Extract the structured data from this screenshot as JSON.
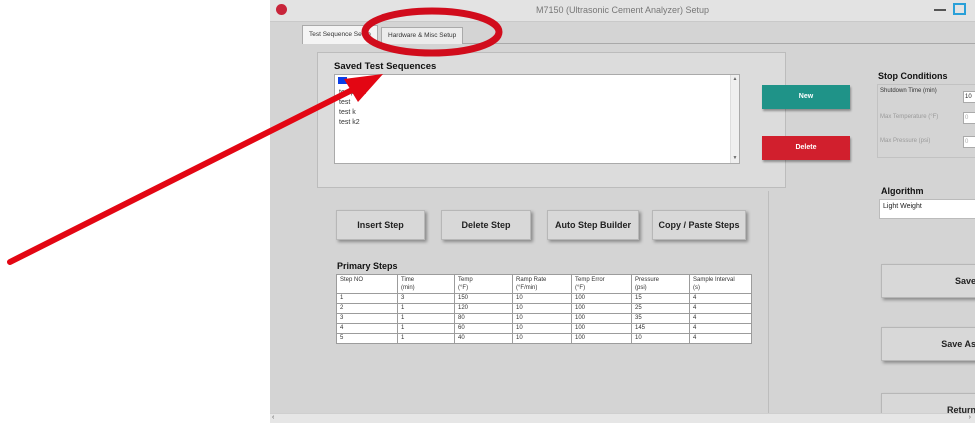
{
  "window": {
    "title": "M7150 (Ultrasonic Cement Analyzer) Setup"
  },
  "tabs": [
    {
      "label": "Test Sequence Setup"
    },
    {
      "label": "Hardware & Misc Setup"
    }
  ],
  "saved_sequences": {
    "title": "Saved Test Sequences",
    "items": [
      "temptest",
      "test",
      "test k",
      "test k2"
    ],
    "new_label": "New",
    "delete_label": "Delete"
  },
  "step_buttons": {
    "insert": "Insert Step",
    "delete": "Delete Step",
    "auto": "Auto Step Builder",
    "copy": "Copy / Paste Steps"
  },
  "primary_steps": {
    "title": "Primary Steps",
    "headers": [
      [
        "Step NO",
        ""
      ],
      [
        "Time",
        "(min)"
      ],
      [
        "Temp",
        "(°F)"
      ],
      [
        "Ramp Rate",
        "(°F/min)"
      ],
      [
        "Temp Error",
        "(°F)"
      ],
      [
        "Pressure",
        "(psi)"
      ],
      [
        "Sample Interval",
        "(s)"
      ]
    ],
    "rows": [
      [
        "1",
        "3",
        "150",
        "10",
        "100",
        "15",
        "4"
      ],
      [
        "2",
        "1",
        "120",
        "10",
        "100",
        "25",
        "4"
      ],
      [
        "3",
        "1",
        "80",
        "10",
        "100",
        "35",
        "4"
      ],
      [
        "4",
        "1",
        "60",
        "10",
        "100",
        "145",
        "4"
      ],
      [
        "5",
        "1",
        "40",
        "10",
        "100",
        "10",
        "4"
      ]
    ]
  },
  "stop_conditions": {
    "title": "Stop Conditions",
    "shutdown_label": "Shutdown Time (min)",
    "shutdown_value": "10",
    "max_temp_label": "Max Temperature (°F)",
    "max_temp_value": "0",
    "max_pressure_label": "Max Pressure (psi)",
    "max_pressure_value": "0"
  },
  "algorithm": {
    "title": "Algorithm",
    "value": "Light Weight"
  },
  "side_buttons": {
    "save": "Save",
    "save_as": "Save As",
    "return": "Return"
  },
  "colors": {
    "new_button": "#1f9388",
    "delete_button": "#d11f2d",
    "annotation": "#e30613"
  },
  "icons": {
    "app": "app-icon",
    "arrow": "red-annotation-arrow"
  }
}
